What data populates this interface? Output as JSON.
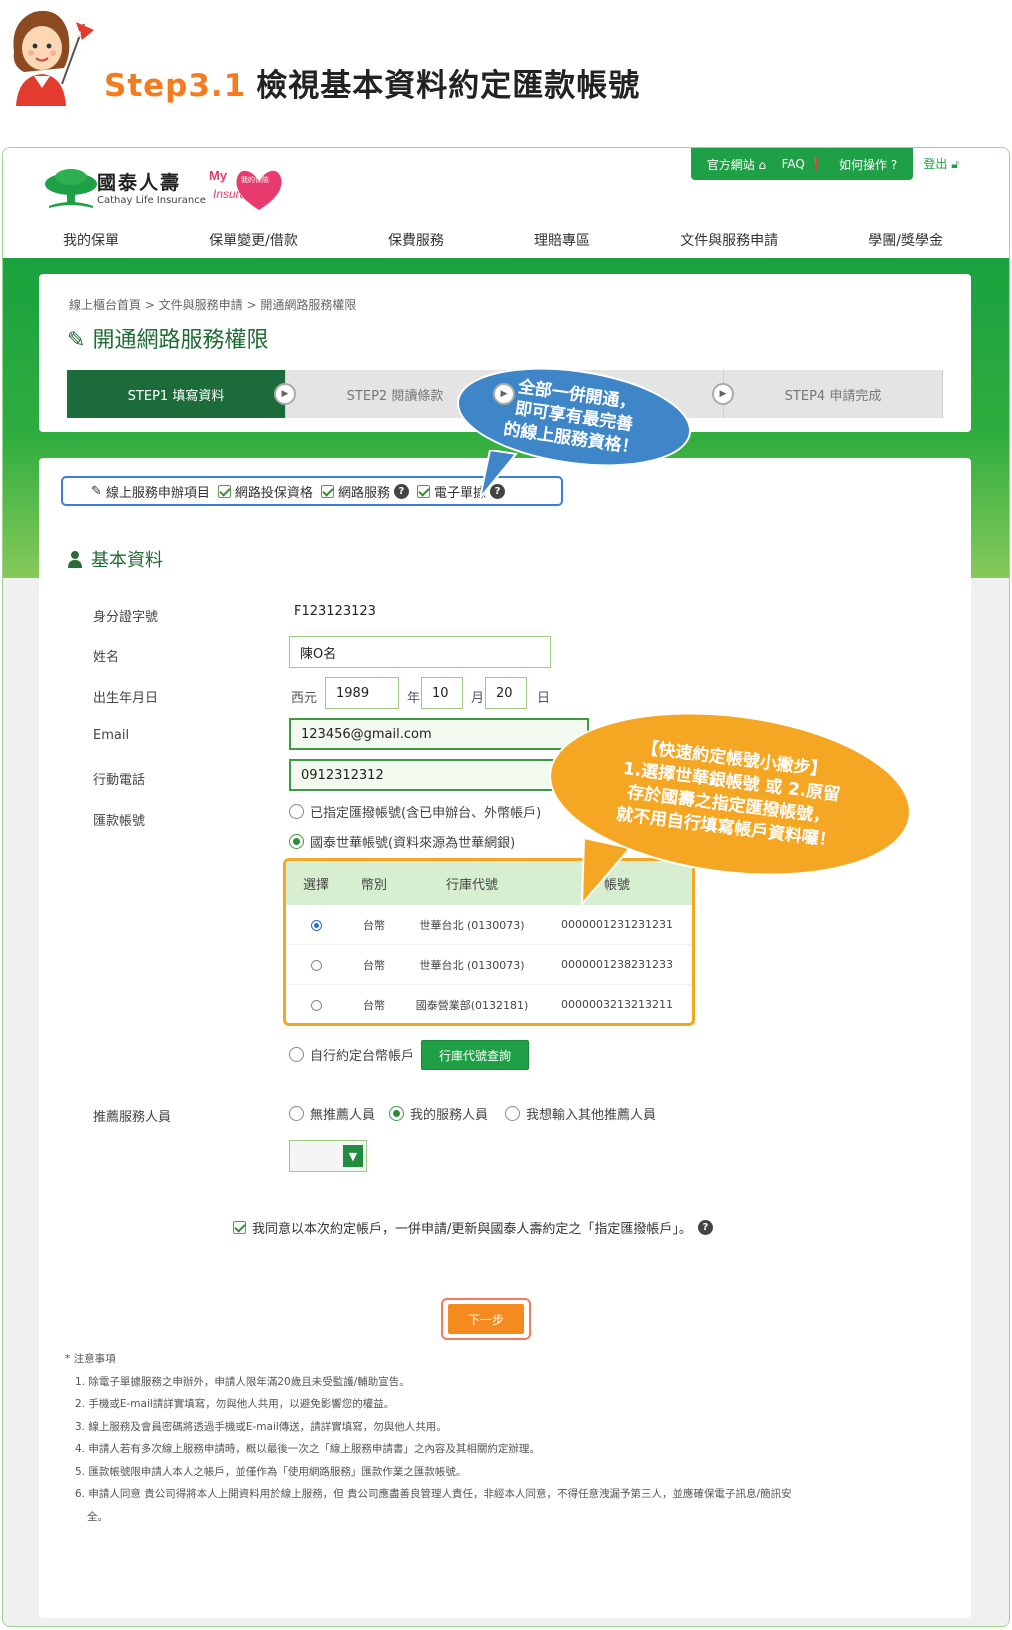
{
  "header": {
    "step_label": "Step3.1",
    "title": "檢視基本資料約定匯款帳號",
    "mascot_flag": "3"
  },
  "topbar": {
    "official": "官方網站",
    "faq": "FAQ",
    "howto": "如何操作",
    "logout": "登出"
  },
  "brand": {
    "name": "國泰人壽",
    "en": "Cathay Life Insurance",
    "my": "My",
    "sub": "我的保險",
    "insurance": "Insurance"
  },
  "nav": [
    "我的保單",
    "保單變更/借款",
    "保費服務",
    "理賠專區",
    "文件與服務申請",
    "學團/獎學金"
  ],
  "breadcrumb": "線上櫃台首頁 > 文件與服務申請 > 開通網路服務權限",
  "page_title": "開通網路服務權限",
  "steps": [
    "STEP1 填寫資料",
    "STEP2 閱讀條款",
    "",
    "STEP4 申請完成"
  ],
  "services": {
    "label": "線上服務申辦項目",
    "items": [
      "網路投保資格",
      "網路服務",
      "電子單據"
    ]
  },
  "section": "基本資料",
  "fields": {
    "id_label": "身分證字號",
    "id_value": "F123123123",
    "name_label": "姓名",
    "name_value": "陳O名",
    "birth_label": "出生年月日",
    "era": "西元",
    "year": "1989",
    "year_unit": "年",
    "month": "10",
    "month_unit": "月",
    "day": "20",
    "day_unit": "日",
    "email_label": "Email",
    "email_value": "123456@gmail.com",
    "phone_label": "行動電話",
    "phone_value": "0912312312",
    "account_label": "匯款帳號",
    "opt_designated": "已指定匯撥帳號(含已申辦台、外幣帳戶)",
    "opt_cathay": "國泰世華帳號(資料來源為世華網銀)",
    "opt_self": "自行約定台幣帳戶",
    "bank_lookup": "行庫代號查詢",
    "referral_label": "推薦服務人員",
    "ref_none": "無推薦人員",
    "ref_mine": "我的服務人員",
    "ref_other": "我想輸入其他推薦人員"
  },
  "account_table": {
    "headers": [
      "選擇",
      "幣別",
      "行庫代號",
      "帳號"
    ],
    "rows": [
      {
        "currency": "台幣",
        "bank": "世華台北 (0130073)",
        "account": "0000001231231231"
      },
      {
        "currency": "台幣",
        "bank": "世華台北 (0130073)",
        "account": "0000001238231233"
      },
      {
        "currency": "台幣",
        "bank": "國泰營業部(0132181)",
        "account": "0000003213213211"
      }
    ]
  },
  "agree_text": "我同意以本次約定帳戶，一併申請/更新與國泰人壽約定之「指定匯撥帳戶」。",
  "next_button": "下一步",
  "notes": {
    "title": "* 注意事項",
    "items": [
      "1. 除電子單據服務之申辦外，申請人限年滿20歲且未受監護/輔助宣告。",
      "2. 手機或E-mail請詳實填寫，勿與他人共用，以避免影響您的權益。",
      "3. 線上服務及會員密碼將透過手機或E-mail傳送，請詳實填寫，勿與他人共用。",
      "4. 申請人若有多次線上服務申請時，概以最後一次之「線上服務申請書」之內容及其相關約定辦理。",
      "5. 匯款帳號限申請人本人之帳戶，並僅作為「使用網路服務」匯款作業之匯款帳號。",
      "6. 申請人同意 貴公司得將本人上開資料用於線上服務，但 貴公司應盡善良管理人責任，非經本人同意，不得任意洩漏予第三人，並應確保電子訊息/簡訊安",
      "全。"
    ]
  },
  "callout_blue": [
    "全部一併開通，",
    "即可享有最完善",
    "的線上服務資格！"
  ],
  "callout_orange": [
    "【快速約定帳號小撇步】",
    "1.選擇世華銀帳號 或 2.原留",
    "存於國壽之指定匯撥帳號，",
    "就不用自行填寫帳戶資料囉！"
  ],
  "colors": {
    "brand_green": "#1f9f46",
    "dark_green": "#1c6b3a",
    "orange": "#f58a1f",
    "callout_blue": "#3f86c8",
    "callout_orange": "#f5a623",
    "step_orange": "#f47b20"
  }
}
